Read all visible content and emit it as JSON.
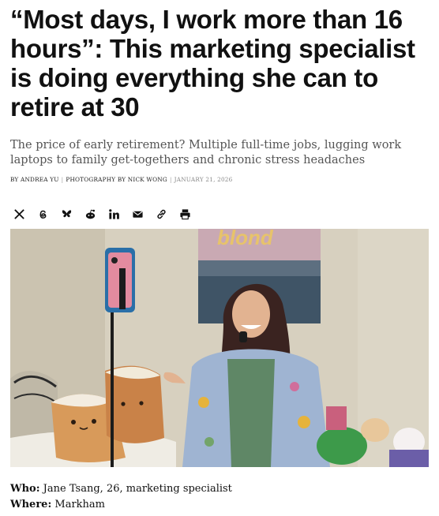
{
  "article": {
    "headline": "“Most days, I work more than 16 hours”: This marketing specialist is doing everything she can to retire at 30",
    "dek": "The price of early retirement? Multiple full-time jobs, lugging work laptops to family get-togethers and chronic stress headaches",
    "byline": {
      "author": "BY ANDREA YU",
      "photography": "PHOTOGRAPHY BY NICK WONG",
      "date": "JANUARY 21, 2026"
    },
    "share_icons": [
      "x-icon",
      "threads-icon",
      "bluesky-icon",
      "reddit-icon",
      "linkedin-icon",
      "email-icon",
      "link-icon",
      "print-icon"
    ],
    "photo": {
      "poster_text": "blond"
    },
    "facts": [
      {
        "label": "Who:",
        "value": "Jane Tsang, 26, marketing specialist"
      },
      {
        "label": "Where:",
        "value": "Markham"
      }
    ]
  }
}
